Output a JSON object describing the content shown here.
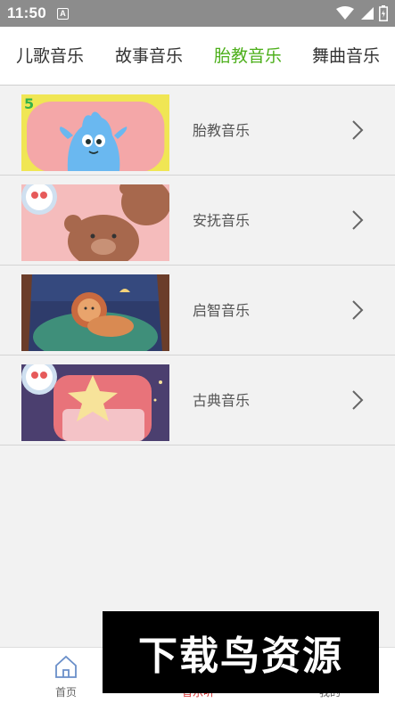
{
  "status_bar": {
    "time": "11:50",
    "notification_letter": "A",
    "icons": [
      "wifi-icon",
      "signal-icon",
      "battery-icon"
    ]
  },
  "tabs": [
    {
      "label": "儿歌音乐",
      "active": false
    },
    {
      "label": "故事音乐",
      "active": false
    },
    {
      "label": "胎教音乐",
      "active": true
    },
    {
      "label": "舞曲音乐",
      "active": false
    }
  ],
  "list": [
    {
      "label": "胎教音乐",
      "thumb": "blue-monster-thumbnail"
    },
    {
      "label": "安抚音乐",
      "thumb": "bear-thumbnail"
    },
    {
      "label": "启智音乐",
      "thumb": "lion-thumbnail"
    },
    {
      "label": "古典音乐",
      "thumb": "star-chair-thumbnail"
    }
  ],
  "bottom_nav": [
    {
      "label": "首页",
      "icon": "home-icon",
      "active": false
    },
    {
      "label": "音乐听",
      "icon": "music-icon",
      "active": true
    },
    {
      "label": "我的",
      "icon": "profile-icon",
      "active": false
    }
  ],
  "watermark": {
    "text": "下载鸟资源"
  },
  "colors": {
    "accent": "#4caf1a",
    "status_bar": "#8c8c8c",
    "background": "#f2f2f2",
    "nav_active": "#d32f2f"
  }
}
